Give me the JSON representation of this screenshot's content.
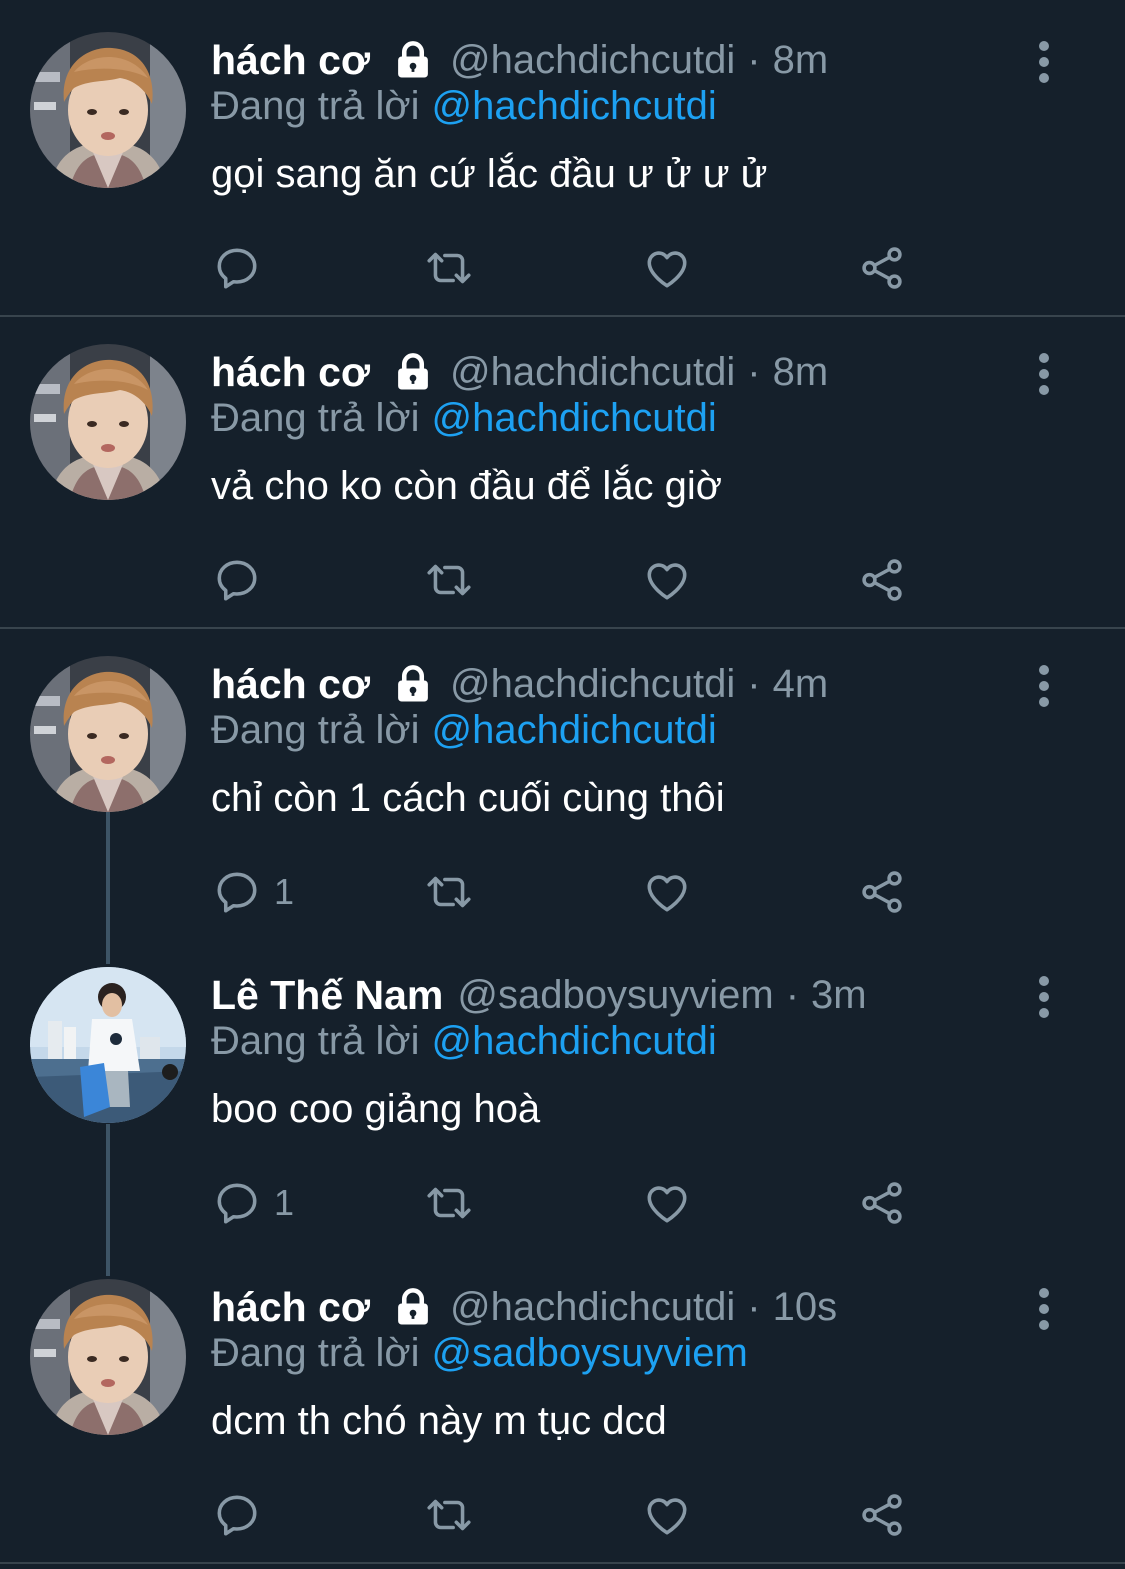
{
  "reply_prefix": "Đang trả lời",
  "colors": {
    "background": "#15202b",
    "muted": "#8899a6",
    "accent": "#1da1f2",
    "divider": "#38444d"
  },
  "icons": {
    "reply": "reply-icon",
    "retweet": "retweet-icon",
    "like": "heart-icon",
    "share": "share-icon",
    "more": "more-vertical-icon",
    "lock": "lock-icon"
  },
  "tweets": [
    {
      "name": "hách cơ",
      "handle": "@hachdichcutdi",
      "sep": "·",
      "time": "8m",
      "reply_to": "@hachdichcutdi",
      "text": "gọi sang ăn cứ lắc đầu ư ử ư ử",
      "reply_count": ""
    },
    {
      "name": "hách cơ",
      "handle": "@hachdichcutdi",
      "sep": "·",
      "time": "8m",
      "reply_to": "@hachdichcutdi",
      "text": "vả cho ko còn đầu để lắc giờ",
      "reply_count": ""
    },
    {
      "name": "hách cơ",
      "handle": "@hachdichcutdi",
      "sep": "·",
      "time": "4m",
      "reply_to": "@hachdichcutdi",
      "text": "chỉ còn 1 cách cuối cùng thôi",
      "reply_count": "1"
    },
    {
      "name": "Lê Thế Nam",
      "handle": "@sadboysuyviem",
      "sep": "·",
      "time": "3m",
      "reply_to": "@hachdichcutdi",
      "text": "boo coo giảng hoà",
      "reply_count": "1"
    },
    {
      "name": "hách cơ",
      "handle": "@hachdichcutdi",
      "sep": "·",
      "time": "10s",
      "reply_to": "@sadboysuyviem",
      "text": "dcm th chó này m tục dcd",
      "reply_count": ""
    }
  ]
}
